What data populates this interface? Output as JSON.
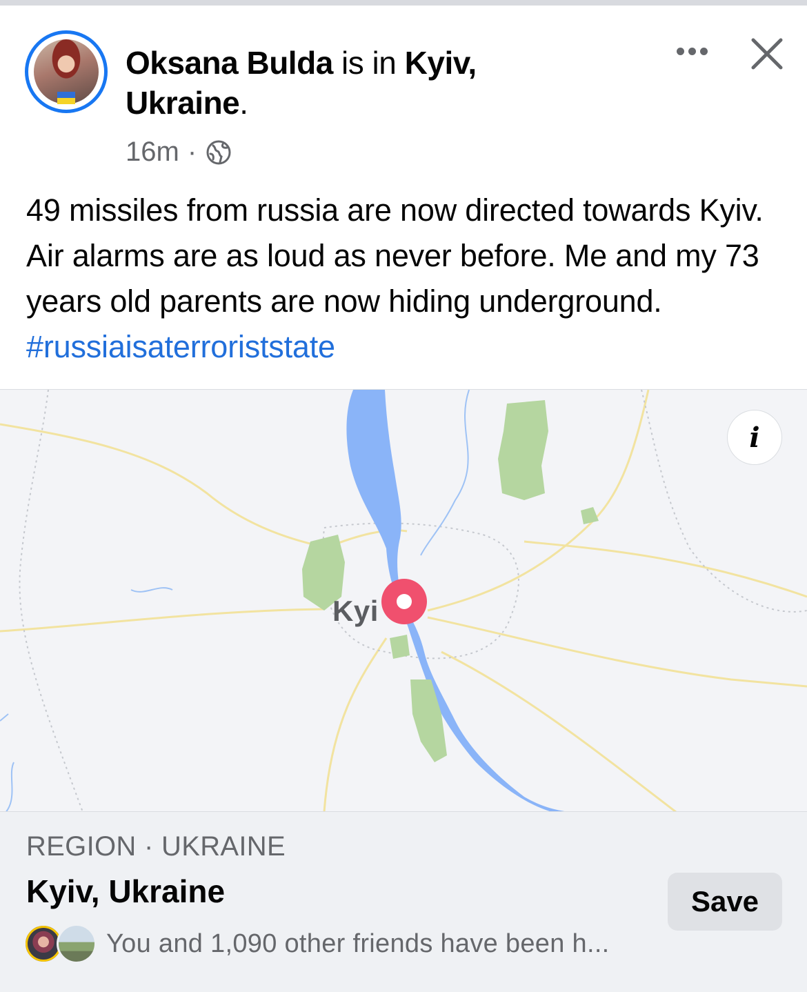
{
  "post": {
    "author_name": "Oksana Bulda",
    "is_in_text": " is in ",
    "location_first": "Kyiv,",
    "location_second": "Ukraine",
    "period": ".",
    "time": "16m",
    "separator": "·",
    "privacy_icon": "globe-icon",
    "more_icon": "more-options-icon",
    "close_icon": "close-icon",
    "text": "49 missiles from russia are now directed towards Kyiv. Air alarms are as loud as never before. Me and my 73 years old parents are now hiding underground. ",
    "hashtag": "#russiaisaterroriststate"
  },
  "map": {
    "city_label": "Kyi",
    "info_icon": "info-icon",
    "info_glyph": "i",
    "pin_icon": "location-pin-icon"
  },
  "place_card": {
    "region_label": "REGION · UKRAINE",
    "name": "Kyiv, Ukraine",
    "save_label": "Save",
    "friends_text": "You and 1,090 other friends have been h..."
  },
  "colors": {
    "accent": "#1877f2",
    "link": "#216fdb",
    "secondary_text": "#65676b",
    "pin": "#f0506e",
    "water": "#8ab4f8",
    "park": "#b5d6a0"
  }
}
